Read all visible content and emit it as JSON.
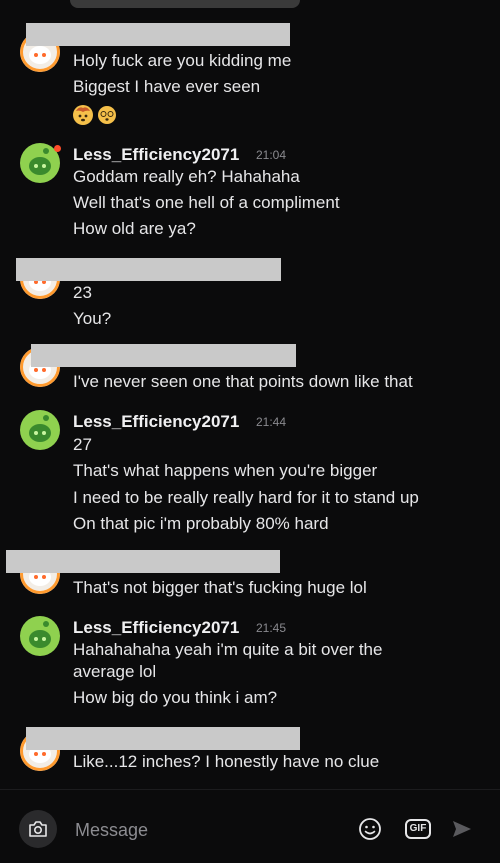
{
  "messages": [
    {
      "lines": [
        "Holy fuck are you kidding me",
        "Biggest I have ever seen"
      ],
      "emojis": [
        "exploding-head-emoji",
        "dizzy-face-emoji"
      ]
    },
    {
      "username": "Less_Efficiency2071",
      "time": "21:04",
      "lines": [
        "Goddam really eh? Hahahaha",
        "Well that's one hell of a compliment",
        "How old are ya?"
      ]
    },
    {
      "lines": [
        "23",
        "You?"
      ]
    },
    {
      "lines": [
        "I've never seen one that points down like that"
      ]
    },
    {
      "username": "Less_Efficiency2071",
      "time": "21:44",
      "lines": [
        "27",
        "That's what happens when you're bigger",
        "I need to be really really hard for it to stand up",
        "On that pic i'm probably 80% hard"
      ]
    },
    {
      "lines": [
        "That's not bigger that's fucking huge lol"
      ]
    },
    {
      "username": "Less_Efficiency2071",
      "time": "21:45",
      "lines": [
        "Hahahahaha yeah i'm quite a bit over the",
        "average lol",
        "How big do you think i am?"
      ]
    },
    {
      "lines": [
        "Like...12 inches? I honestly have no clue"
      ]
    }
  ],
  "composer": {
    "placeholder": "Message",
    "camera_icon": "camera-icon",
    "emoji_icon": "emoji-icon",
    "gif_label": "GIF",
    "send_icon": "send-icon"
  },
  "colors": {
    "background": "#0b0b0c",
    "redaction": "#c9c9c9",
    "avatar_green": "#8fd14f",
    "avatar_ring": "#ff9a2e",
    "online_dot": "#ff4e2a"
  }
}
